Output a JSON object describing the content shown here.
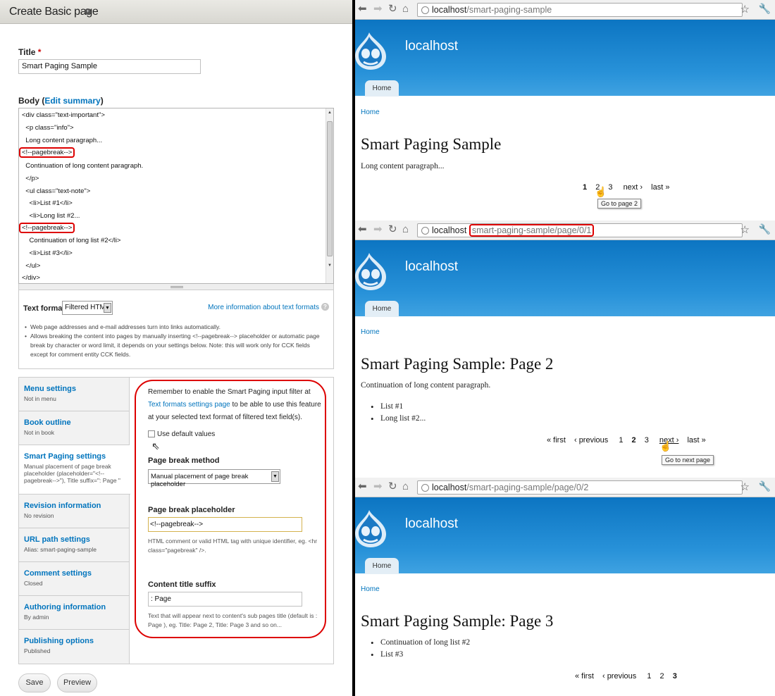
{
  "form": {
    "overlay_title": "Create Basic page",
    "title_label": "Title",
    "required_mark": "*",
    "title_value": "Smart Paging Sample",
    "body_label": "Body (",
    "edit_summary": "Edit summary",
    "body_label_close": ")",
    "body_lines": [
      "<div class=\"text-important\">",
      "  <p class=\"info\">",
      "  Long content paragraph...",
      "<!--pagebreak-->",
      "  Continuation of long content paragraph.",
      "  </p>",
      "  <ul class=\"text-note\">",
      "    <li>List #1</li>",
      "    <li>Long list #2...",
      "<!--pagebreak-->",
      "    Continuation of long list #2</li>",
      "    <li>List #3</li>",
      "  </ul>",
      "</div>"
    ],
    "text_format_label": "Text format",
    "text_format_value": "Filtered HTML",
    "more_info_formats": "More information about text formats",
    "format_tips": [
      "Web page addresses and e-mail addresses turn into links automatically.",
      "Allows breaking the content into pages by manually inserting <!--pagebreak--> placeholder or automatic page break by character or word limit, it depends on your settings below. Note: this will work only for CCK fields except for comment entity CCK fields."
    ],
    "vtabs": [
      {
        "title": "Menu settings",
        "summary": "Not in menu"
      },
      {
        "title": "Book outline",
        "summary": "Not in book"
      },
      {
        "title": "Smart Paging settings",
        "summary": "Manual placement of page break placeholder (placeholder=\"<!--pagebreak-->\"), Title suffix=\": Page \""
      },
      {
        "title": "Revision information",
        "summary": "No revision"
      },
      {
        "title": "URL path settings",
        "summary": "Alias: smart-paging-sample"
      },
      {
        "title": "Comment settings",
        "summary": "Closed"
      },
      {
        "title": "Authoring information",
        "summary": "By admin"
      },
      {
        "title": "Publishing options",
        "summary": "Published"
      }
    ],
    "pane": {
      "note_start": "Remember to enable the Smart Paging input filter at ",
      "note_link": "Text formats settings page",
      "note_end": " to be able to use this feature at your selected text format of filtered text field(s).",
      "use_default": "Use default values",
      "method_label": "Page break method",
      "method_value": "Manual placement of page break placeholder",
      "placeholder_label": "Page break placeholder",
      "placeholder_value": "<!--pagebreak-->",
      "placeholder_help": "HTML comment or valid HTML tag with unique identifier, eg. <hr class=\"pagebreak\" />.",
      "suffix_label": "Content title suffix",
      "suffix_value": ": Page",
      "suffix_help": "Text that will appear next to content's sub pages title (default is : Page ), eg. Title: Page 2, Title: Page 3 and so on..."
    },
    "save": "Save",
    "preview": "Preview"
  },
  "browsers": [
    {
      "url_host": "localhost",
      "url_path": "/smart-paging-sample",
      "site": "localhost",
      "home_tab": "Home",
      "breadcrumb": "Home",
      "title": "Smart Paging Sample",
      "paragraph": "Long content paragraph...",
      "pager": [
        "1",
        "2",
        "3",
        "next ›",
        "last »"
      ],
      "tooltip": "Go to page 2"
    },
    {
      "url_host": "localhost",
      "url_path": "smart-paging-sample/page/0/1",
      "site": "localhost",
      "home_tab": "Home",
      "breadcrumb": "Home",
      "title": "Smart Paging Sample: Page 2",
      "paragraph": "Continuation of long content paragraph.",
      "list": [
        "List #1",
        "Long list #2..."
      ],
      "pager": [
        "« first",
        "‹ previous",
        "1",
        "2",
        "3",
        "next ›",
        "last »"
      ],
      "tooltip": "Go to next page"
    },
    {
      "url_host": "localhost",
      "url_path": "/smart-paging-sample/page/0/2",
      "site": "localhost",
      "home_tab": "Home",
      "breadcrumb": "Home",
      "title": "Smart Paging Sample: Page 3",
      "list": [
        "Continuation of long list #2",
        "List #3"
      ],
      "pager": [
        "« first",
        "‹ previous",
        "1",
        "2",
        "3"
      ]
    }
  ]
}
